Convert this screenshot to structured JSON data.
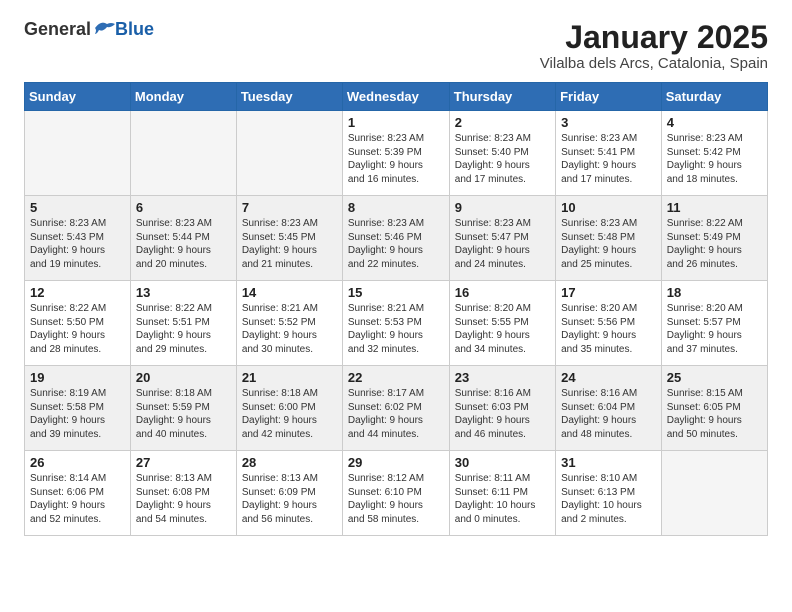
{
  "header": {
    "logo_general": "General",
    "logo_blue": "Blue",
    "month": "January 2025",
    "location": "Vilalba dels Arcs, Catalonia, Spain"
  },
  "weekdays": [
    "Sunday",
    "Monday",
    "Tuesday",
    "Wednesday",
    "Thursday",
    "Friday",
    "Saturday"
  ],
  "weeks": [
    [
      {
        "day": "",
        "info": ""
      },
      {
        "day": "",
        "info": ""
      },
      {
        "day": "",
        "info": ""
      },
      {
        "day": "1",
        "info": "Sunrise: 8:23 AM\nSunset: 5:39 PM\nDaylight: 9 hours\nand 16 minutes."
      },
      {
        "day": "2",
        "info": "Sunrise: 8:23 AM\nSunset: 5:40 PM\nDaylight: 9 hours\nand 17 minutes."
      },
      {
        "day": "3",
        "info": "Sunrise: 8:23 AM\nSunset: 5:41 PM\nDaylight: 9 hours\nand 17 minutes."
      },
      {
        "day": "4",
        "info": "Sunrise: 8:23 AM\nSunset: 5:42 PM\nDaylight: 9 hours\nand 18 minutes."
      }
    ],
    [
      {
        "day": "5",
        "info": "Sunrise: 8:23 AM\nSunset: 5:43 PM\nDaylight: 9 hours\nand 19 minutes."
      },
      {
        "day": "6",
        "info": "Sunrise: 8:23 AM\nSunset: 5:44 PM\nDaylight: 9 hours\nand 20 minutes."
      },
      {
        "day": "7",
        "info": "Sunrise: 8:23 AM\nSunset: 5:45 PM\nDaylight: 9 hours\nand 21 minutes."
      },
      {
        "day": "8",
        "info": "Sunrise: 8:23 AM\nSunset: 5:46 PM\nDaylight: 9 hours\nand 22 minutes."
      },
      {
        "day": "9",
        "info": "Sunrise: 8:23 AM\nSunset: 5:47 PM\nDaylight: 9 hours\nand 24 minutes."
      },
      {
        "day": "10",
        "info": "Sunrise: 8:23 AM\nSunset: 5:48 PM\nDaylight: 9 hours\nand 25 minutes."
      },
      {
        "day": "11",
        "info": "Sunrise: 8:22 AM\nSunset: 5:49 PM\nDaylight: 9 hours\nand 26 minutes."
      }
    ],
    [
      {
        "day": "12",
        "info": "Sunrise: 8:22 AM\nSunset: 5:50 PM\nDaylight: 9 hours\nand 28 minutes."
      },
      {
        "day": "13",
        "info": "Sunrise: 8:22 AM\nSunset: 5:51 PM\nDaylight: 9 hours\nand 29 minutes."
      },
      {
        "day": "14",
        "info": "Sunrise: 8:21 AM\nSunset: 5:52 PM\nDaylight: 9 hours\nand 30 minutes."
      },
      {
        "day": "15",
        "info": "Sunrise: 8:21 AM\nSunset: 5:53 PM\nDaylight: 9 hours\nand 32 minutes."
      },
      {
        "day": "16",
        "info": "Sunrise: 8:20 AM\nSunset: 5:55 PM\nDaylight: 9 hours\nand 34 minutes."
      },
      {
        "day": "17",
        "info": "Sunrise: 8:20 AM\nSunset: 5:56 PM\nDaylight: 9 hours\nand 35 minutes."
      },
      {
        "day": "18",
        "info": "Sunrise: 8:20 AM\nSunset: 5:57 PM\nDaylight: 9 hours\nand 37 minutes."
      }
    ],
    [
      {
        "day": "19",
        "info": "Sunrise: 8:19 AM\nSunset: 5:58 PM\nDaylight: 9 hours\nand 39 minutes."
      },
      {
        "day": "20",
        "info": "Sunrise: 8:18 AM\nSunset: 5:59 PM\nDaylight: 9 hours\nand 40 minutes."
      },
      {
        "day": "21",
        "info": "Sunrise: 8:18 AM\nSunset: 6:00 PM\nDaylight: 9 hours\nand 42 minutes."
      },
      {
        "day": "22",
        "info": "Sunrise: 8:17 AM\nSunset: 6:02 PM\nDaylight: 9 hours\nand 44 minutes."
      },
      {
        "day": "23",
        "info": "Sunrise: 8:16 AM\nSunset: 6:03 PM\nDaylight: 9 hours\nand 46 minutes."
      },
      {
        "day": "24",
        "info": "Sunrise: 8:16 AM\nSunset: 6:04 PM\nDaylight: 9 hours\nand 48 minutes."
      },
      {
        "day": "25",
        "info": "Sunrise: 8:15 AM\nSunset: 6:05 PM\nDaylight: 9 hours\nand 50 minutes."
      }
    ],
    [
      {
        "day": "26",
        "info": "Sunrise: 8:14 AM\nSunset: 6:06 PM\nDaylight: 9 hours\nand 52 minutes."
      },
      {
        "day": "27",
        "info": "Sunrise: 8:13 AM\nSunset: 6:08 PM\nDaylight: 9 hours\nand 54 minutes."
      },
      {
        "day": "28",
        "info": "Sunrise: 8:13 AM\nSunset: 6:09 PM\nDaylight: 9 hours\nand 56 minutes."
      },
      {
        "day": "29",
        "info": "Sunrise: 8:12 AM\nSunset: 6:10 PM\nDaylight: 9 hours\nand 58 minutes."
      },
      {
        "day": "30",
        "info": "Sunrise: 8:11 AM\nSunset: 6:11 PM\nDaylight: 10 hours\nand 0 minutes."
      },
      {
        "day": "31",
        "info": "Sunrise: 8:10 AM\nSunset: 6:13 PM\nDaylight: 10 hours\nand 2 minutes."
      },
      {
        "day": "",
        "info": ""
      }
    ]
  ]
}
